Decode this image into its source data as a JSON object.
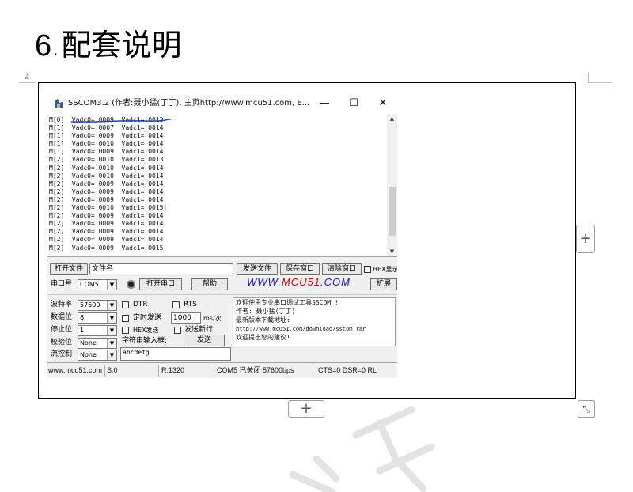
{
  "document": {
    "section_number": "6",
    "section_dot": ".",
    "section_title": "配套说明",
    "side_plus": "+",
    "bottom_plus": "+",
    "resize_icon": "resize-diagonal-icon",
    "anchor_icon": "anchor-icon"
  },
  "app": {
    "title": "SSCOM3.2 (作者:聂小猛(丁丁), 主页http://www.mcu51.com,  E...",
    "window_buttons": {
      "minimize": "—",
      "maximize": "☐",
      "close": "✕"
    },
    "output_lines": [
      "M[0]  Vadc0= 0009  Vadc1= 0013",
      "M[1]  Vadc0= 0007  Vadc1= 0014",
      "M[1]  Vadc0= 0009  Vadc1= 0014",
      "M[1]  Vadc0= 0010  Vadc1= 0014",
      "M[1]  Vadc0= 0009  Vadc1= 0014",
      "M[2]  Vadc0= 0010  Vadc1= 0013",
      "M[2]  Vadc0= 0010  Vadc1= 0014",
      "M[2]  Vadc0= 0010  Vadc1= 0014",
      "M[2]  Vadc0= 0009  Vadc1= 0014",
      "M[2]  Vadc0= 0009  Vadc1= 0014",
      "M[2]  Vadc0= 0009  Vadc1= 0014",
      "M[2]  Vadc0= 0010  Vadc1= 0015|",
      "M[2]  Vadc0= 0009  Vadc1= 0014",
      "M[2]  Vadc0= 0009  Vadc1= 0014",
      "M[2]  Vadc0= 0009  Vadc1= 0014",
      "M[2]  Vadc0= 0009  Vadc1= 0014",
      "M[2]  Vadc0= 0009  Vadc1= 0015"
    ],
    "toolbar1": {
      "open_file": "打开文件",
      "file_name_value": "文件名",
      "send_file": "发送文件",
      "save_window": "保存窗口",
      "clear_window": "清除窗口",
      "hex_display": "HEX显示"
    },
    "toolbar2": {
      "port_label": "串口号",
      "port_value": "COM5",
      "open_port": "打开串口",
      "help": "帮助",
      "brand_a": "WWW.",
      "brand_b": "MCU51",
      "brand_c": ".COM",
      "expand": "扩展"
    },
    "settings": {
      "baud_label": "波特率",
      "baud_value": "57600",
      "data_bits_label": "数据位",
      "data_bits_value": "8",
      "stop_bits_label": "停止位",
      "stop_bits_value": "1",
      "parity_label": "校验位",
      "parity_value": "None",
      "flow_label": "流控制",
      "flow_value": "None"
    },
    "options": {
      "dtr": "DTR",
      "rts": "RTS",
      "timed_send": "定时发送",
      "interval_value": "1000",
      "interval_unit": "ms/次",
      "hex_send": "HEX发送",
      "send_newline": "发送新行",
      "input_label": "字符串输入框:",
      "send_button": "发送",
      "input_value": "abcdefg"
    },
    "info_lines": [
      "欢迎使用专业串口调试工具SSCOM !",
      "作者: 聂小猛(丁丁)",
      "最新版本下载地址:",
      "http://www.mcu51.com/download/sscom.rar",
      "欢迎提出您的建议!"
    ],
    "status": {
      "site": "www.mcu51.com",
      "sent": "S:0",
      "received": "R:1320",
      "port_state": "COM5 已关闭  57600bps",
      "lines": "CTS=0 DSR=0 RL"
    }
  },
  "colors": {
    "brand_blue": "#1414c8",
    "brand_red": "#e00000",
    "frame_border": "#000000",
    "strike_blue": "#1a3fd1"
  }
}
